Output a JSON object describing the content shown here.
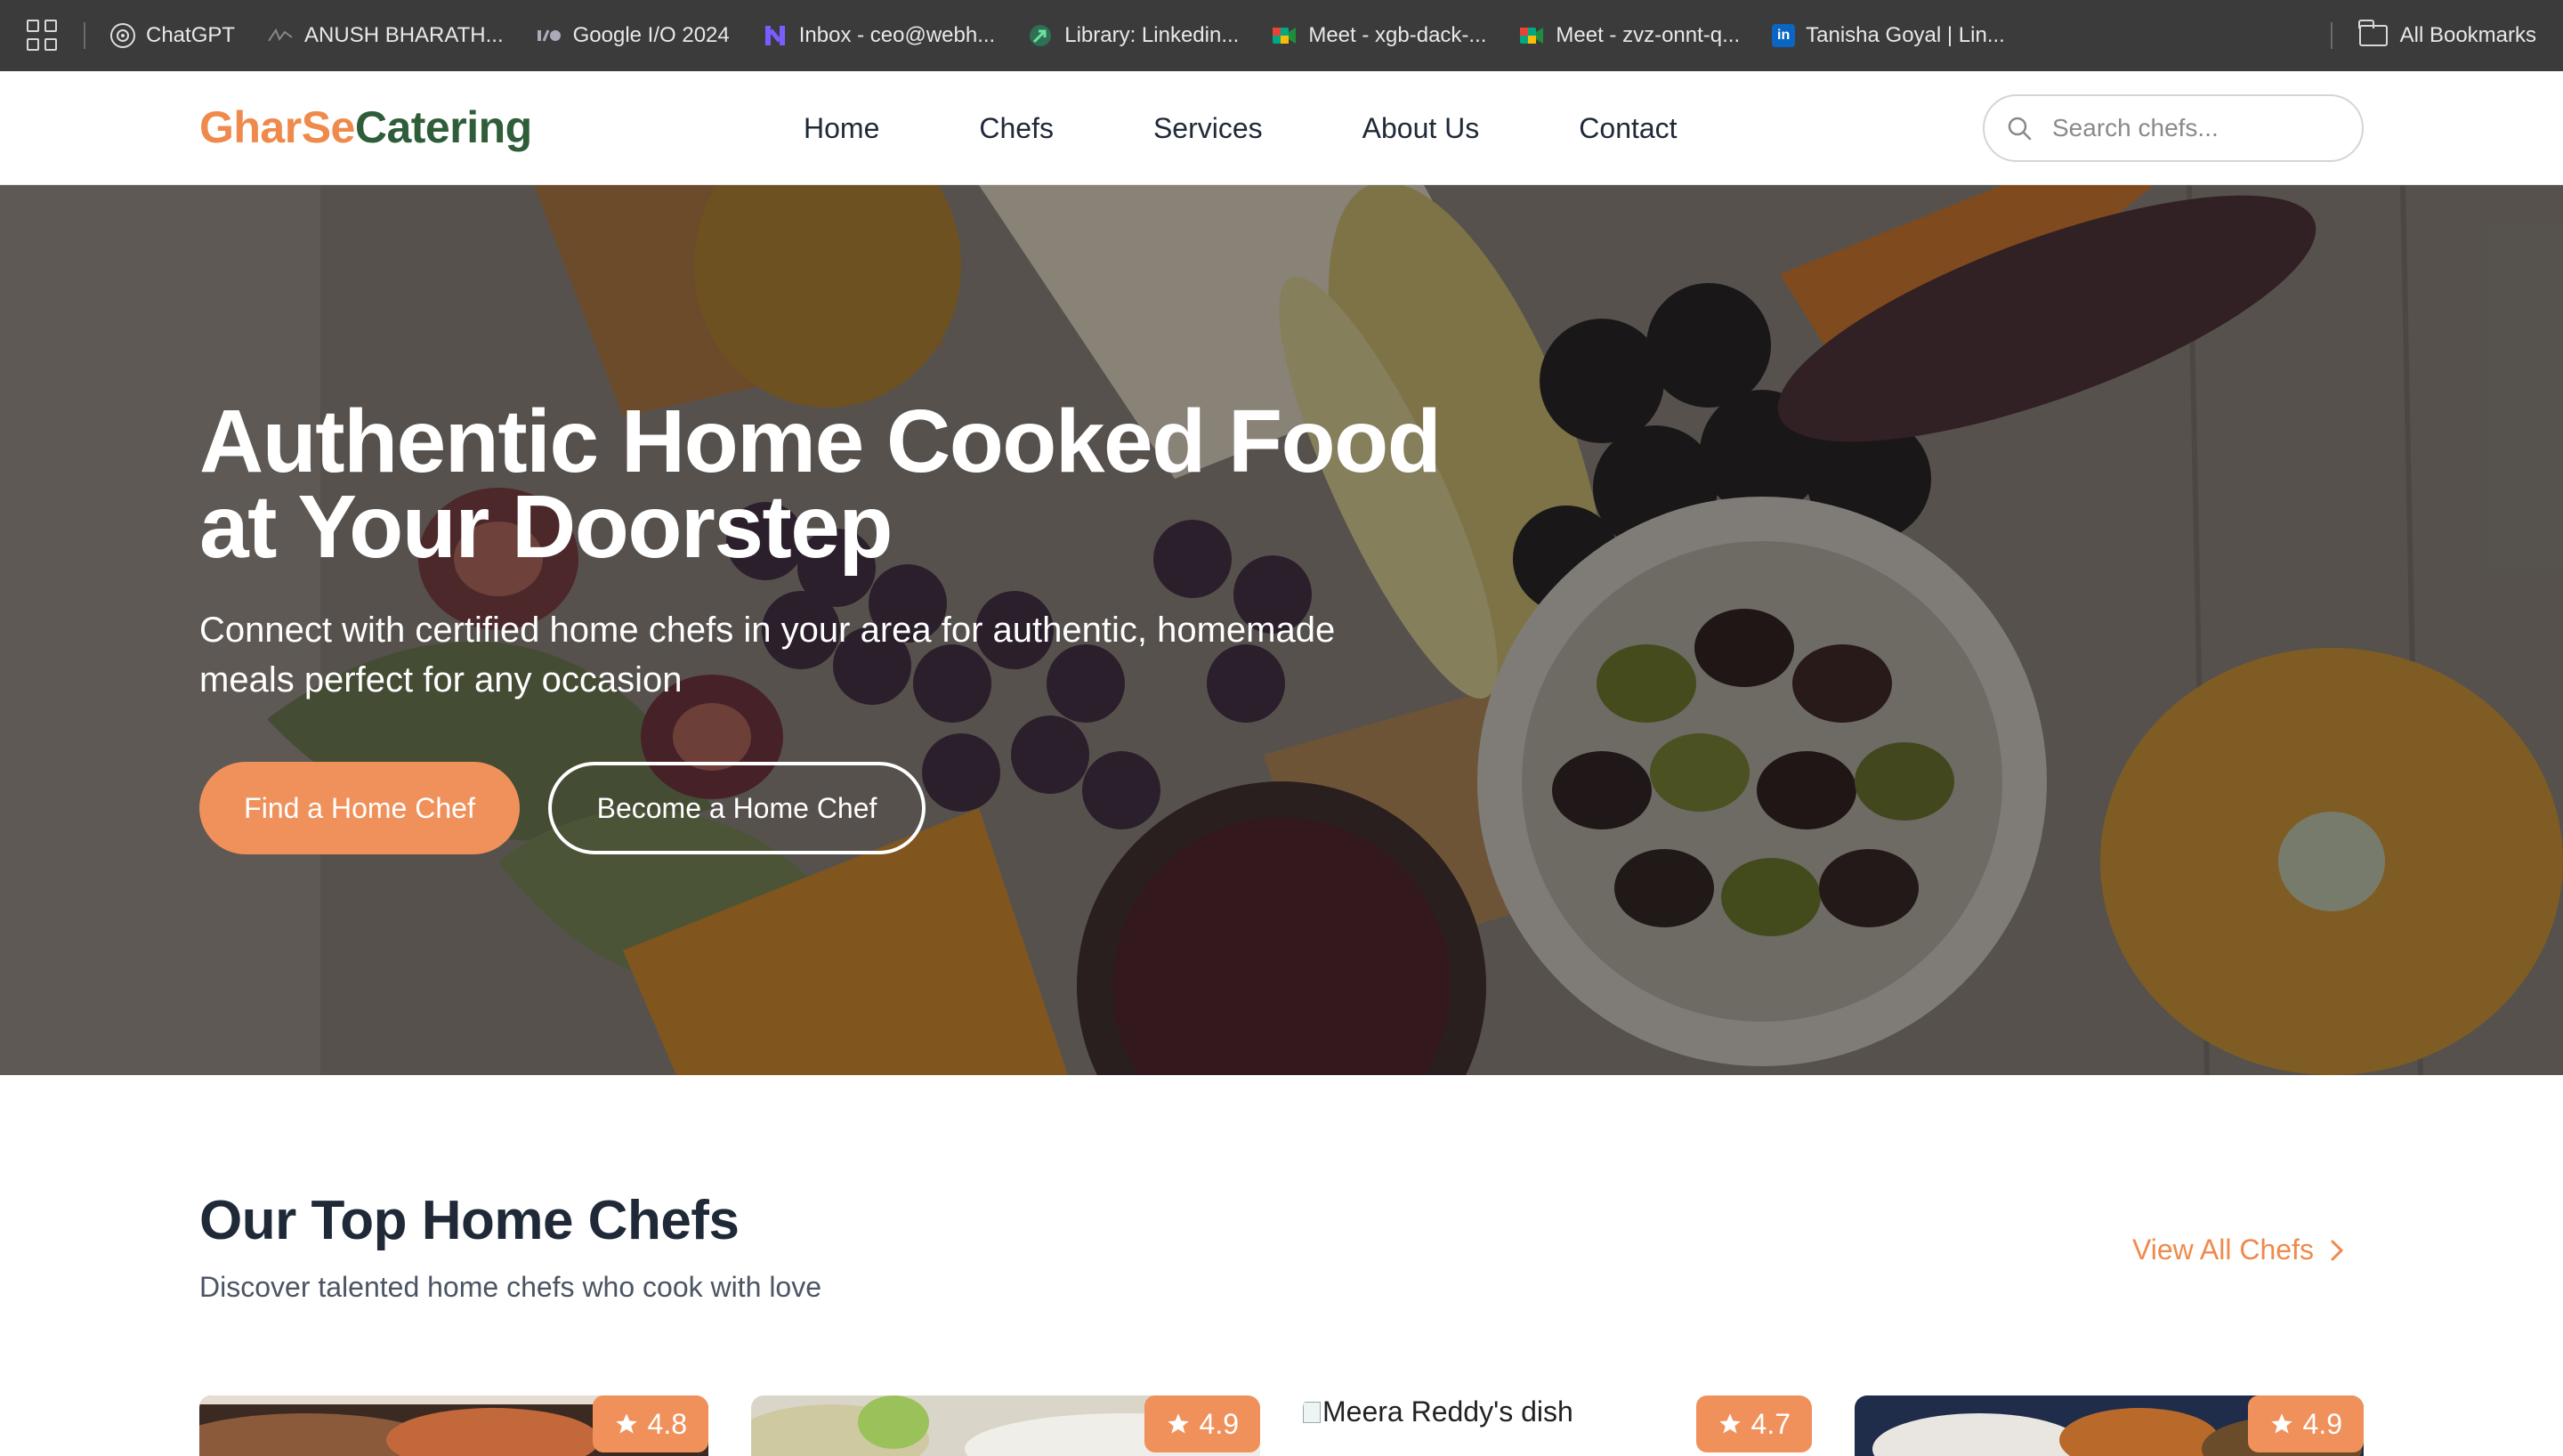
{
  "bookmarks": {
    "items": [
      {
        "label": "ChatGPT",
        "icon": "chatgpt-icon",
        "color": "#ffffff"
      },
      {
        "label": "ANUSH BHARATH...",
        "icon": "signature-icon",
        "color": "#777777"
      },
      {
        "label": "Google I/O 2024",
        "icon": "io-icon",
        "color": "#9aa0a6"
      },
      {
        "label": "Inbox - ceo@webh...",
        "icon": "inbox-icon",
        "color": "#6c4cf1"
      },
      {
        "label": "Library: Linkedin...",
        "icon": "library-icon",
        "color": "#2fa36b"
      },
      {
        "label": "Meet - xgb-dack-...",
        "icon": "meet-icon",
        "color": "#00897b"
      },
      {
        "label": "Meet - zvz-onnt-q...",
        "icon": "meet-icon",
        "color": "#00897b"
      },
      {
        "label": "Tanisha Goyal | Lin...",
        "icon": "linkedin-icon",
        "color": "#0a66c2"
      }
    ],
    "all_bookmarks": "All Bookmarks"
  },
  "nav": {
    "logo_part1": "GharSe",
    "logo_part2": "Catering",
    "links": [
      "Home",
      "Chefs",
      "Services",
      "About Us",
      "Contact"
    ],
    "search_placeholder": "Search chefs..."
  },
  "hero": {
    "title": "Authentic Home Cooked Food at Your Doorstep",
    "subtitle": "Connect with certified home chefs in your area for authentic, homemade meals perfect for any occasion",
    "primary_button": "Find a Home Chef",
    "secondary_button": "Become a Home Chef"
  },
  "top_chefs": {
    "title": "Our Top Home Chefs",
    "subtitle": "Discover talented home chefs who cook with love",
    "view_all": "View All Chefs",
    "cards": [
      {
        "rating": "4.8"
      },
      {
        "rating": "4.9"
      },
      {
        "rating": "4.7",
        "image_alt": "Meera Reddy's dish"
      },
      {
        "rating": "4.9"
      }
    ]
  },
  "colors": {
    "accent": "#f0915b",
    "logo_green": "#2f5d3a",
    "bookmarks_bar": "#3b3b3c"
  }
}
